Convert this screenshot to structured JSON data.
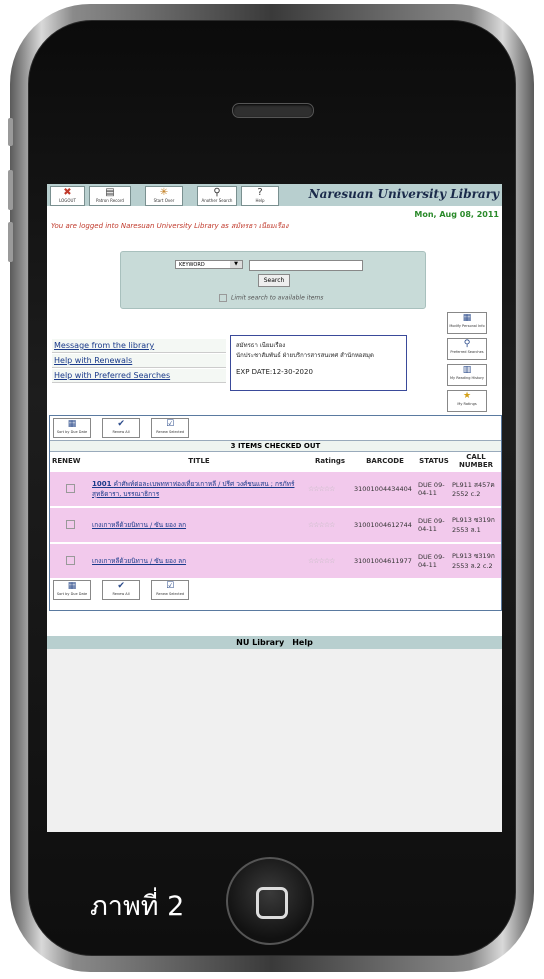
{
  "toolbar": {
    "buttons": [
      {
        "label": "LOGOUT",
        "icon": "✖"
      },
      {
        "label": "Patron Record",
        "icon": "▤"
      },
      {
        "label": "Start Over",
        "icon": "✳"
      },
      {
        "label": "Another Search",
        "icon": "⚲"
      },
      {
        "label": "Help",
        "icon": "?"
      }
    ],
    "brand": "Naresuan University Library"
  },
  "date": "Mon, Aug 08, 2011",
  "logged_in": "You are logged into Naresuan University Library as สมัทรธา เนียมเรือง",
  "search": {
    "select_value": "KEYWORD",
    "button": "Search",
    "limit": "Limit search to available items"
  },
  "links": [
    "Message from the library",
    "Help with Renewals",
    "Help with Preferred Searches"
  ],
  "patron": {
    "name": "สมัทรธา เนียมเรือง",
    "dept": "นักประชาสัมพันธ์ ฝ่ายบริการสารสนเทศ สำนักหอสมุด",
    "exp": "EXP DATE:12-30-2020"
  },
  "side_icons": [
    "Modify Personal Info",
    "Preferred Searches",
    "My Reading History",
    "My Ratings"
  ],
  "panel_buttons": [
    "Sort by Due Date",
    "Renew All",
    "Renew Selected"
  ],
  "checked_out_title": "3 ITEMS CHECKED OUT",
  "columns": {
    "renew": "RENEW",
    "title": "TITLE",
    "ratings": "Ratings",
    "barcode": "BARCODE",
    "status": "STATUS",
    "call": "CALL NUMBER"
  },
  "items": [
    {
      "num": "1001",
      "title": "คำศัพท์ต่อละเบพทหาห่องเที่ยวเกาหลี / ปรีศ วงศ์ชนแสน ; กรภัทร์ สุทธิดารา, บรรณาธิการ",
      "barcode": "31001004434404",
      "status": "DUE 09-04-11",
      "call": "PL911 ส457ค 2552 c.2"
    },
    {
      "num": "",
      "title": "เกงเกาหลีด้วยนิทาน / ซัน ยอง ลก",
      "barcode": "31001004612744",
      "status": "DUE 09-04-11",
      "call": "PL913 ซ319ก 2553 ล.1"
    },
    {
      "num": "",
      "title": "เกงเกาหลีด้วยนิทาน / ซัน ยอง ลก",
      "barcode": "31001004611977",
      "status": "DUE 09-04-11",
      "call": "PL913 ซ319ก 2553 ล.2 c.2"
    }
  ],
  "footer": [
    "NU Library",
    "Help"
  ],
  "caption": "ภาพที่ 2"
}
